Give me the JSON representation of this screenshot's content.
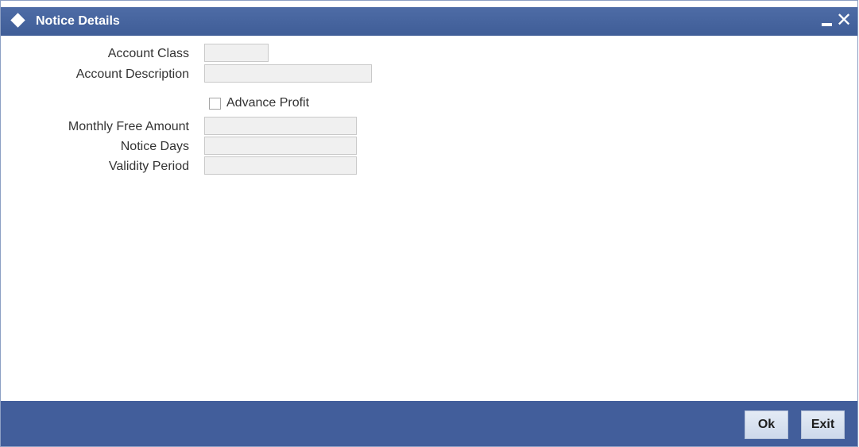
{
  "window": {
    "title": "Notice Details"
  },
  "form": {
    "account_class_label": "Account Class",
    "account_class_value": "",
    "account_description_label": "Account Description",
    "account_description_value": "",
    "advance_profit_label": "Advance Profit",
    "advance_profit_checked": false,
    "monthly_free_amount_label": "Monthly Free Amount",
    "monthly_free_amount_value": "",
    "notice_days_label": "Notice Days",
    "notice_days_value": "",
    "validity_period_label": "Validity Period",
    "validity_period_value": ""
  },
  "footer": {
    "ok_label": "Ok",
    "exit_label": "Exit"
  },
  "colors": {
    "titlebar": "#3f5d97",
    "footer": "#425e9b",
    "field_bg": "#f0f0f0"
  },
  "icons": {
    "title": "diamond-icon",
    "minimize": "minimize-icon",
    "close": "close-icon"
  }
}
